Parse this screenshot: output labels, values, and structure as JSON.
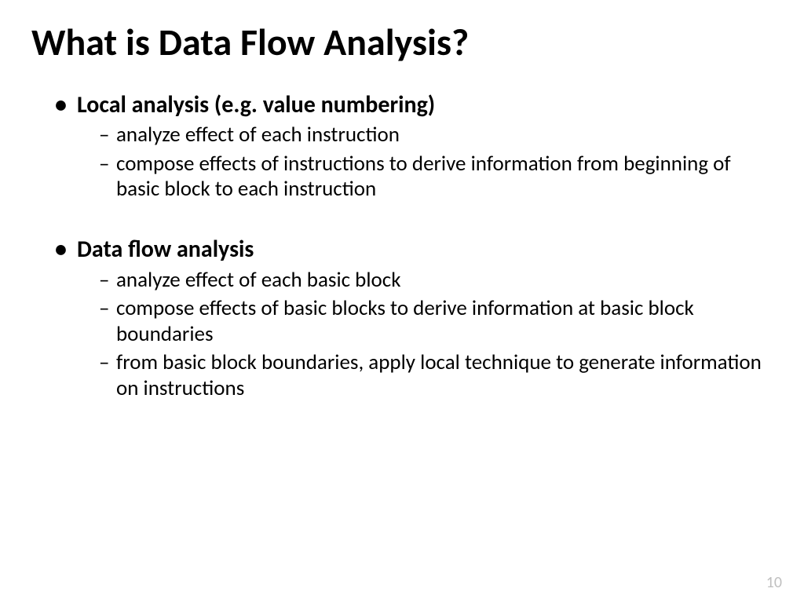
{
  "title": "What is Data Flow Analysis?",
  "bullets": {
    "b1": {
      "heading": "Local analysis (e.g. value numbering)",
      "s1": "analyze effect of each instruction",
      "s2": "compose effects of instructions to derive information from beginning of basic block to each instruction"
    },
    "b2": {
      "heading": "Data flow analysis",
      "s1": "analyze effect of each basic block",
      "s2": "compose effects of basic blocks to derive information at basic block boundaries",
      "s3": "from basic block boundaries, apply local technique to generate information on instructions"
    }
  },
  "page_number": "10"
}
